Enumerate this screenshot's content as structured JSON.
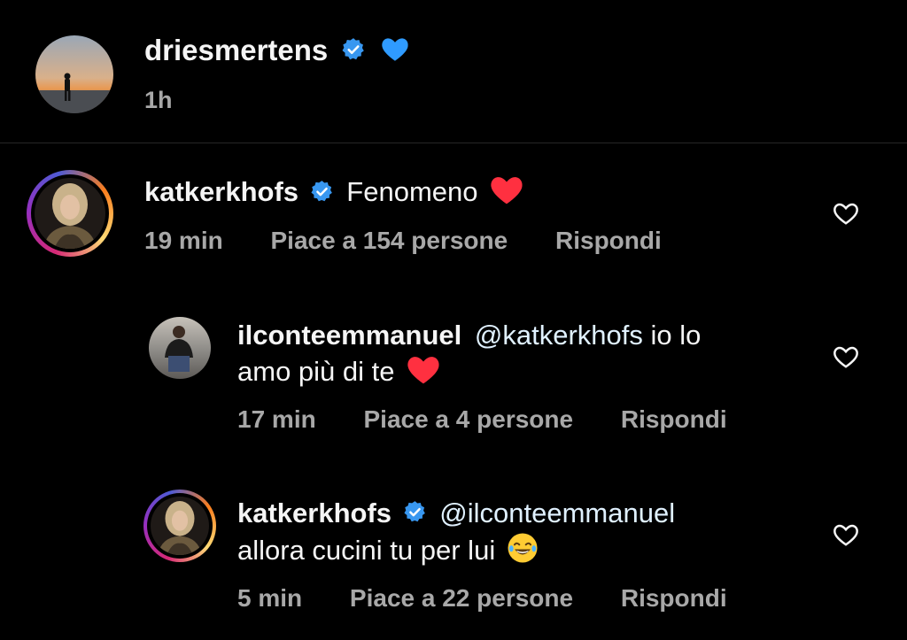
{
  "post": {
    "author": "driesmertens",
    "time": "1h"
  },
  "comments": [
    {
      "username": "katkerkhofs",
      "text": "Fenomeno",
      "time": "19 min",
      "likes": "Piace a 154 persone",
      "reply_label": "Rispondi"
    },
    {
      "username": "ilconteemmanuel",
      "mention": "@katkerkhofs",
      "text_line1": "io lo",
      "text_line2": "amo più di te",
      "time": "17 min",
      "likes": "Piace a 4 persone",
      "reply_label": "Rispondi"
    },
    {
      "username": "katkerkhofs",
      "mention": "@ilconteemmanuel",
      "text_line2": "allora cucini tu per lui",
      "time": "5 min",
      "likes": "Piace a 22 persone",
      "reply_label": "Rispondi"
    }
  ],
  "colors": {
    "background": "#000000",
    "text": "#f5f5f5",
    "meta": "#a8a8a8",
    "verified": "#3897f0",
    "red_heart": "#ff3040",
    "blue_heart": "#2f9bff"
  },
  "icons": [
    "verified-badge-icon",
    "blue-heart-emoji-icon",
    "red-heart-emoji-icon",
    "laughing-emoji-icon",
    "like-heart-outline-icon"
  ]
}
